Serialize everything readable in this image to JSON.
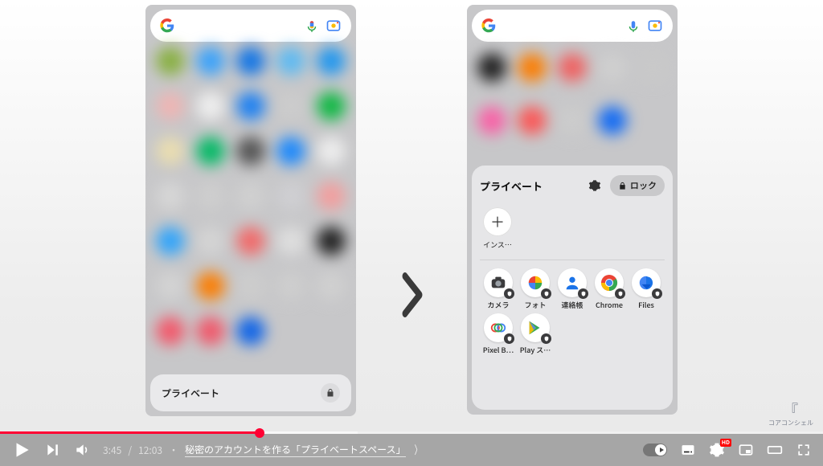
{
  "video": {
    "current_time": "3:45",
    "duration": "12:03",
    "chapter_separator": "・",
    "chapter_title": "秘密のアカウントを作る「プライベートスペース」",
    "hd_badge": "HD"
  },
  "watermark_text": "コアコンシェル",
  "left_phone": {
    "private_label": "プライベート"
  },
  "right_phone": {
    "private_panel": {
      "title": "プライベート",
      "lock_label": "ロック",
      "install_label": "インス…"
    },
    "apps": [
      {
        "label": "カメラ"
      },
      {
        "label": "フォト"
      },
      {
        "label": "連絡帳"
      },
      {
        "label": "Chrome"
      },
      {
        "label": "Files"
      },
      {
        "label": "Pixel B…"
      },
      {
        "label": "Play ス…"
      }
    ]
  }
}
